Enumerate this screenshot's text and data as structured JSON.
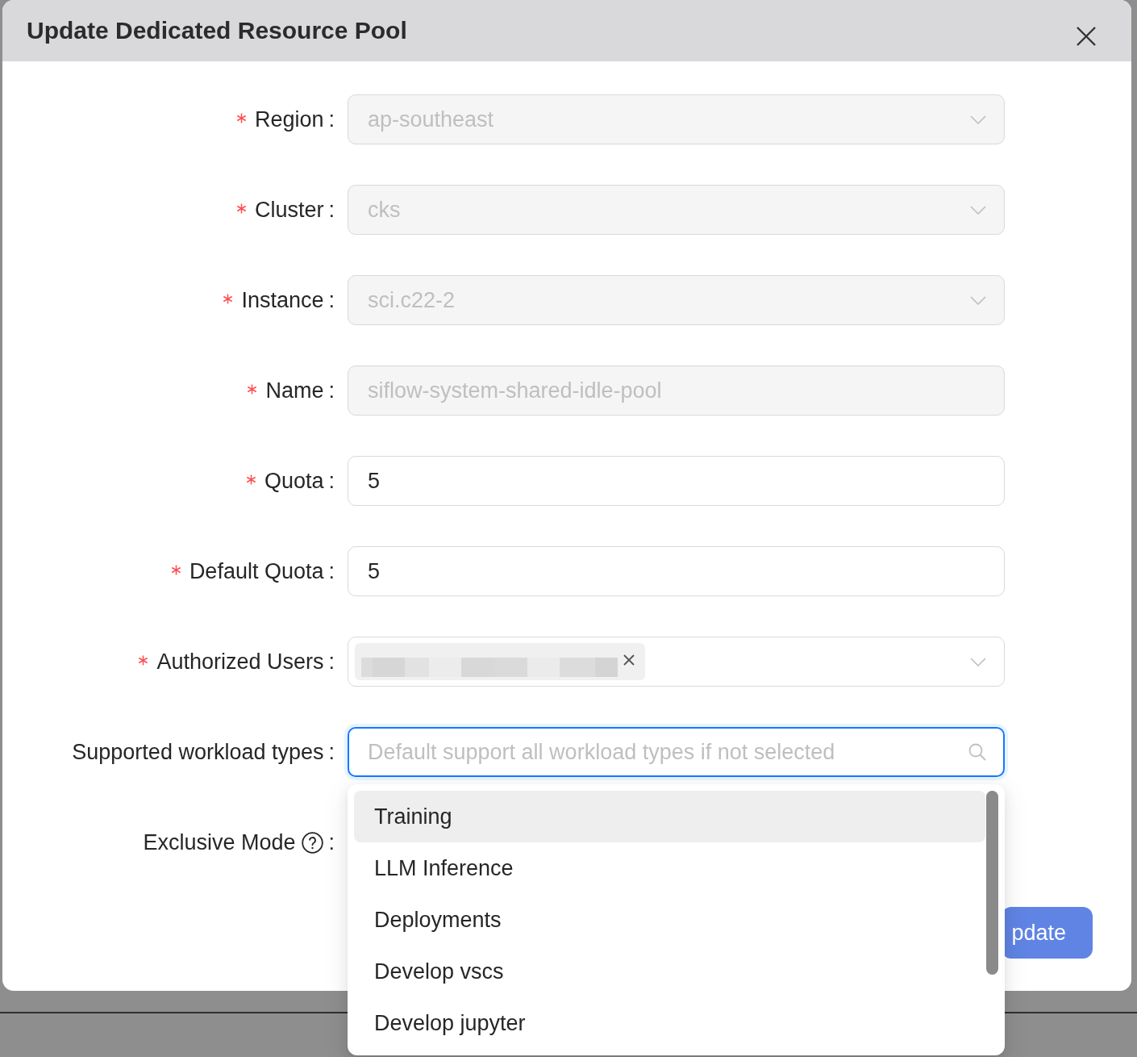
{
  "dialog": {
    "title": "Update Dedicated Resource Pool"
  },
  "form": {
    "fields": [
      {
        "label": "Region",
        "colon": ":",
        "required": true,
        "kind": "select",
        "value": "ap-southeast",
        "disabled": true
      },
      {
        "label": "Cluster",
        "colon": ":",
        "required": true,
        "kind": "select",
        "value": "cks",
        "disabled": true
      },
      {
        "label": "Instance",
        "colon": ":",
        "required": true,
        "kind": "select",
        "value": "sci.c22-2",
        "disabled": true
      },
      {
        "label": "Name",
        "colon": ":",
        "required": true,
        "kind": "input",
        "value": "siflow-system-shared-idle-pool",
        "disabled": true
      },
      {
        "label": "Quota",
        "colon": ":",
        "required": true,
        "kind": "input",
        "value": "5",
        "disabled": false
      },
      {
        "label": "Default Quota",
        "colon": ":",
        "required": true,
        "kind": "input",
        "value": "5",
        "disabled": false
      },
      {
        "label": "Authorized Users",
        "colon": ":",
        "required": true,
        "kind": "tags",
        "disabled": false,
        "tags": [
          {
            "kind": "redacted",
            "removable": true
          }
        ]
      },
      {
        "label": "Supported workload types",
        "colon": ":",
        "required": false,
        "kind": "search-select",
        "disabled": false,
        "focused": true,
        "placeholder": "Default support all workload types if not selected",
        "dropdown": {
          "options": [
            {
              "label": "Training",
              "highlighted": true,
              "selected": false
            },
            {
              "label": "LLM Inference",
              "highlighted": false,
              "selected": false
            },
            {
              "label": "Deployments",
              "highlighted": false,
              "selected": false
            },
            {
              "label": "Develop vscs",
              "highlighted": false,
              "selected": false
            },
            {
              "label": "Develop jupyter",
              "highlighted": false,
              "selected": false
            }
          ]
        }
      },
      {
        "label": "Exclusive Mode",
        "colon": ":",
        "required": false,
        "help": true,
        "kind": "covered"
      }
    ]
  },
  "footer": {
    "buttons": [
      {
        "label": "pdate",
        "kind": "primary"
      }
    ]
  }
}
